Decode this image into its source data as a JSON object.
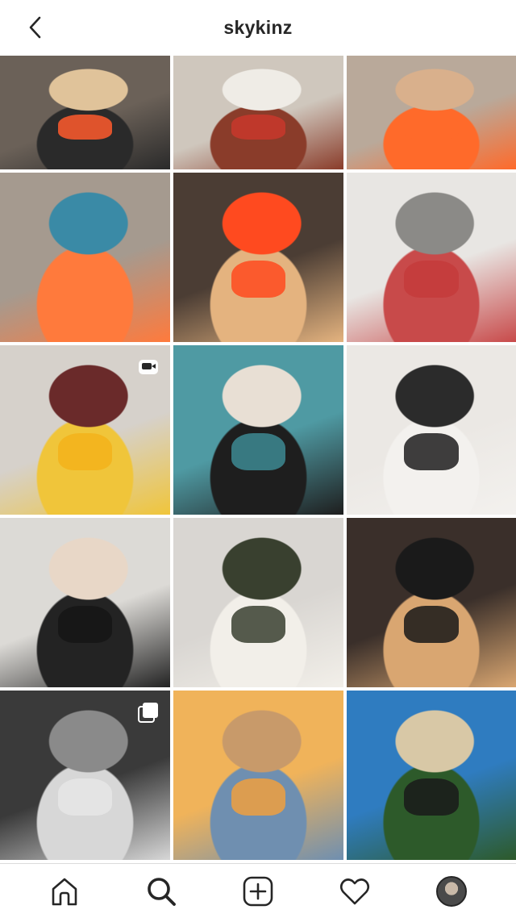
{
  "header": {
    "title": "skykinz",
    "back_icon": "chevron-left-icon"
  },
  "grid": {
    "posts": [
      {
        "colors": [
          "#6b6158",
          "#2a2a2a",
          "#e0c39a"
        ],
        "accent": "#ff5a2d"
      },
      {
        "colors": [
          "#cfc7bd",
          "#8a3c2a",
          "#efece6"
        ],
        "accent": "#c8372b"
      },
      {
        "colors": [
          "#b9a99a",
          "#ff6a2a",
          "#d9b08c"
        ],
        "accent": "#ff6a2a"
      },
      {
        "colors": [
          "#a59a8f",
          "#ff7a3c",
          "#3a8aa6"
        ],
        "accent": "#ff7a3c"
      },
      {
        "colors": [
          "#4b3d34",
          "#e4b37f",
          "#ff4a1f"
        ],
        "accent": "#ff4a1f"
      },
      {
        "colors": [
          "#e8e6e3",
          "#c84a4a",
          "#8b8a87"
        ],
        "accent": "#c43b3b"
      },
      {
        "colors": [
          "#d6d1cb",
          "#f0c53a",
          "#6a2a2a"
        ],
        "accent": "#f3b21b",
        "badge": "video-icon"
      },
      {
        "colors": [
          "#4f9aa3",
          "#1e1e1e",
          "#e8dfd4"
        ],
        "accent": "#3d8a93"
      },
      {
        "colors": [
          "#ebe8e4",
          "#f3f1ee",
          "#2b2b2b"
        ],
        "accent": "#1d1d1d"
      },
      {
        "colors": [
          "#dcdad6",
          "#232323",
          "#e8d7c7"
        ],
        "accent": "#151515"
      },
      {
        "colors": [
          "#d9d6d2",
          "#f2efe9",
          "#39402f"
        ],
        "accent": "#3a4030"
      },
      {
        "colors": [
          "#3a2f2a",
          "#d9a671",
          "#1a1a1a"
        ],
        "accent": "#171717"
      },
      {
        "colors": [
          "#3a3a3a",
          "#d7d7d7",
          "#8a8a8a"
        ],
        "accent": "#e6e6e6",
        "badge": "carousel-icon"
      },
      {
        "colors": [
          "#f0b35a",
          "#6f8fb0",
          "#c89a6a"
        ],
        "accent": "#f0a040"
      },
      {
        "colors": [
          "#2f7cc0",
          "#2d5a2a",
          "#d8c8a6"
        ],
        "accent": "#1a1a1a"
      }
    ]
  },
  "bottom_nav": {
    "items": [
      {
        "name": "home-icon"
      },
      {
        "name": "search-icon"
      },
      {
        "name": "new-post-icon"
      },
      {
        "name": "activity-heart-icon"
      },
      {
        "name": "profile-avatar"
      }
    ]
  }
}
